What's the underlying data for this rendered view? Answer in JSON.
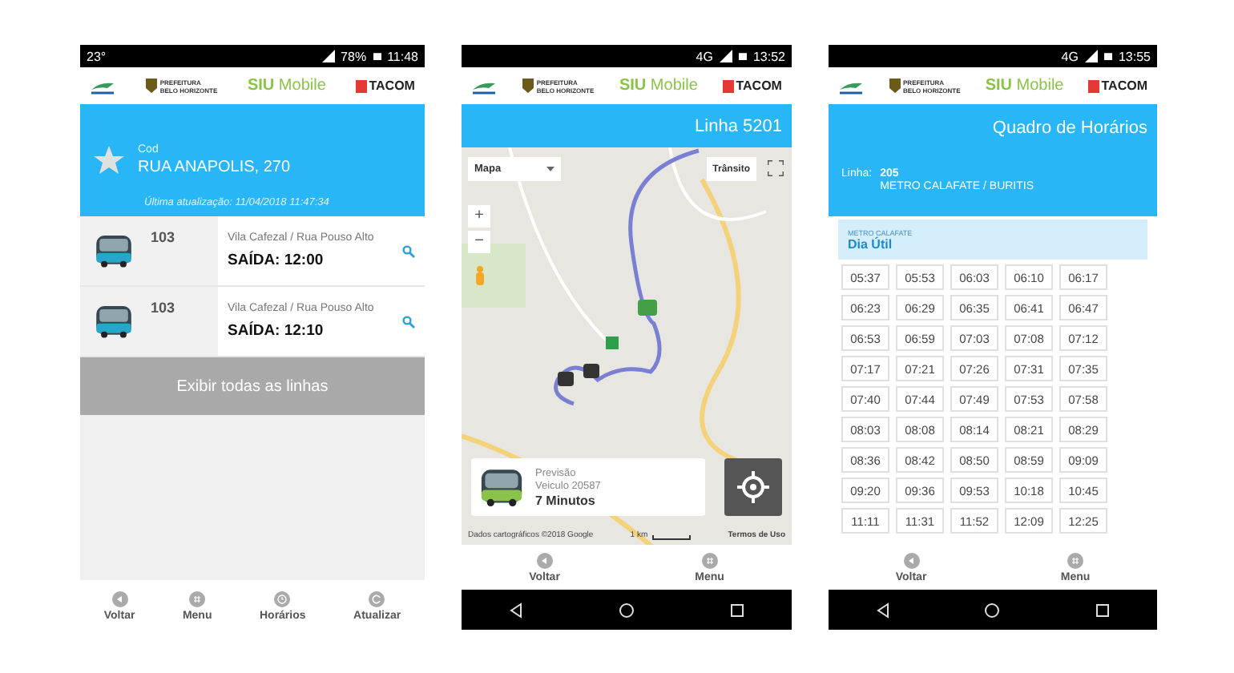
{
  "phones": [
    {
      "kind": "stop",
      "status_bar": {
        "left": "23°",
        "battery": "78%",
        "time": "11:48"
      },
      "header": {
        "city_1": "PREFEITURA",
        "city_2": "BELO HORIZONTE",
        "app_bold": "SIU",
        "app_rest": "Mobile",
        "partner": "TACOM"
      },
      "stop": {
        "label": "Cod",
        "name": "RUA ANAPOLIS, 270",
        "updated": "Última atualização: 11/04/2018 11:47:34"
      },
      "departures": [
        {
          "line": "103",
          "route": "Vila Cafezal / Rua Pouso Alto",
          "time": "SAÍDA: 12:00"
        },
        {
          "line": "103",
          "route": "Vila Cafezal / Rua Pouso Alto",
          "time": "SAÍDA: 12:10"
        }
      ],
      "show_all": "Exibir todas as linhas",
      "bottom_nav": [
        {
          "label": "Voltar"
        },
        {
          "label": "Menu"
        },
        {
          "label": "Horários"
        },
        {
          "label": "Atualizar"
        }
      ],
      "system_nav": false
    },
    {
      "kind": "map",
      "status_bar": {
        "network": "4G",
        "time": "13:52"
      },
      "header": {
        "city_1": "PREFEITURA",
        "city_2": "BELO HORIZONTE",
        "app_bold": "SIU",
        "app_rest": "Mobile",
        "partner": "TACOM"
      },
      "title": "Linha 5201",
      "map": {
        "map_type": "Mapa",
        "traffic": "Trânsito",
        "zoom_in": "+",
        "zoom_out": "−",
        "prediction_label": "Previsão",
        "vehicle": "Veiculo 20587",
        "eta": "7 Minutos",
        "attribution": "Dados cartográficos ©2018 Google",
        "scale": "1 km",
        "terms": "Termos de Uso"
      },
      "bottom_nav": [
        {
          "label": "Voltar"
        },
        {
          "label": "Menu"
        }
      ],
      "system_nav": true
    },
    {
      "kind": "schedule",
      "status_bar": {
        "network": "4G",
        "time": "13:55"
      },
      "header": {
        "city_1": "PREFEITURA",
        "city_2": "BELO HORIZONTE",
        "app_bold": "SIU",
        "app_rest": "Mobile",
        "partner": "TACOM"
      },
      "title": "Quadro de Horários",
      "line_label": "Linha:",
      "line_number": "205",
      "line_name": "METRO CALAFATE / BURITIS",
      "origin": "METRO CALAFATE",
      "day": "Dia Útil",
      "times": [
        "05:37",
        "05:53",
        "06:03",
        "06:10",
        "06:17",
        "06:23",
        "06:29",
        "06:35",
        "06:41",
        "06:47",
        "06:53",
        "06:59",
        "07:03",
        "07:08",
        "07:12",
        "07:17",
        "07:21",
        "07:26",
        "07:31",
        "07:35",
        "07:40",
        "07:44",
        "07:49",
        "07:53",
        "07:58",
        "08:03",
        "08:08",
        "08:14",
        "08:21",
        "08:29",
        "08:36",
        "08:42",
        "08:50",
        "08:59",
        "09:09",
        "09:20",
        "09:36",
        "09:53",
        "10:18",
        "10:45",
        "11:11",
        "11:31",
        "11:52",
        "12:09",
        "12:25"
      ],
      "bottom_nav": [
        {
          "label": "Voltar"
        },
        {
          "label": "Menu"
        }
      ],
      "system_nav": true
    }
  ]
}
